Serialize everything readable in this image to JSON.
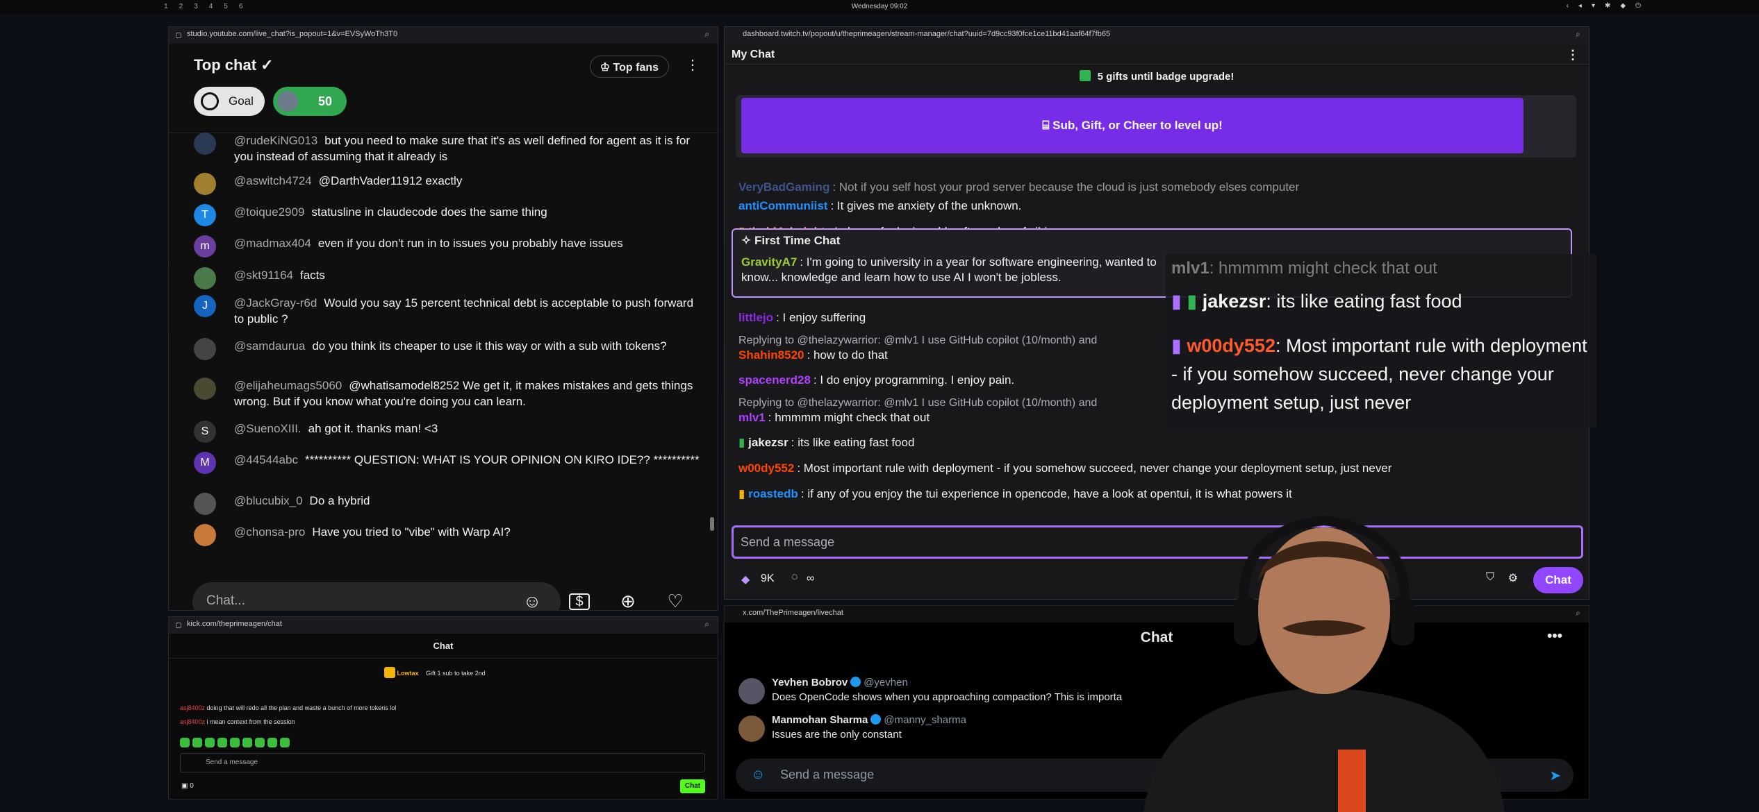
{
  "topbar": {
    "workspaces": [
      "1",
      "2",
      "3",
      "4",
      "5",
      "6"
    ],
    "clock": "Wednesday 09:02"
  },
  "youtube": {
    "url": "studio.youtube.com/live_chat?is_popout=1&v=EVSyWoTh3T0",
    "title": "Top chat",
    "top_fans": "Top fans",
    "goal": "Goal",
    "gift_count": "50",
    "input_placeholder": "Chat...",
    "messages": [
      {
        "author": "@rudeKiNG013",
        "text": "but you need to make sure that it's as well defined for agent as it is for you instead of assuming that it already is",
        "avatar": ""
      },
      {
        "author": "@aswitch4724",
        "text": "@DarthVader11912 exactly",
        "avatar": ""
      },
      {
        "author": "@toique2909",
        "text": "statusline in claudecode does the same thing",
        "avatar": "T"
      },
      {
        "author": "@madmax404",
        "text": "even if you don't run in to issues you probably have issues",
        "avatar": "m"
      },
      {
        "author": "@skt91164",
        "text": "facts",
        "avatar": ""
      },
      {
        "author": "@JackGray-r6d",
        "text": "Would you say 15 percent technical debt is acceptable to push forward to public ?",
        "avatar": "J"
      },
      {
        "author": "@samdaurua",
        "text": "do you think its cheaper to use it this way or with a sub with tokens?",
        "avatar": ""
      },
      {
        "author": "@elijaheumags5060",
        "text": "@whatisamodel8252 We get it, it makes mistakes and gets things wrong. But if you know what you're doing you can learn.",
        "avatar": ""
      },
      {
        "author": "@SuenoXIII.",
        "text": "ah got it. thanks man! <3",
        "avatar": "S"
      },
      {
        "author": "@44544abc",
        "text": "********** QUESTION: WHAT IS YOUR OPINION ON KIRO IDE?? **********",
        "avatar": "M"
      },
      {
        "author": "@blucubix_0",
        "text": "Do a hybrid",
        "avatar": ""
      },
      {
        "author": "@chonsa-pro",
        "text": "Have you tried to \"vibe\" with Warp AI?",
        "avatar": ""
      }
    ]
  },
  "kick": {
    "url": "kick.com/theprimeagen/chat",
    "title": "Chat",
    "pinned_user": "Lowtax",
    "pinned_text": "Gift 1 sub to take 2nd",
    "lines": [
      {
        "user": "asj8400z",
        "text": "doing that will redo all the plan and waste a bunch of more tokens lol"
      },
      {
        "user": "asj8400z",
        "text": "i mean context from the session"
      }
    ],
    "input_placeholder": "Send a message",
    "count": "0",
    "chat_button": "Chat"
  },
  "twitch": {
    "url": "dashboard.twitch.tv/popout/u/theprimeagen/stream-manager/chat?uuid=7d9cc93f0fce1ce11bd41aaf64f7fb65",
    "title": "My Chat",
    "gifts_banner": "5 gifts until badge upgrade!",
    "sub_button": "Sub, Gift, or Cheer to level up!",
    "first_time_chat": "First Time Chat",
    "lines": [
      {
        "user": "VeryBadGaming",
        "text": "Not if you self host your prod server because the cloud is just somebody elses computer",
        "color": "#5b7bd5"
      },
      {
        "user": "antiCommuniist",
        "text": "It gives me anxiety of the unknown.",
        "color": "#1e90ff"
      },
      {
        "user": "thebl4cknight",
        "text": "I always feel miserable after a day of vibing",
        "color": "#ff7f50"
      },
      {
        "user": "GravityA7",
        "text": "I'm going to university in a year for software engineering, wanted to know... knowledge and learn how to use AI I won't be jobless.",
        "color": "#9acd32"
      },
      {
        "user": "littlejo",
        "text": "I enjoy suffering",
        "color": "#8a2be2"
      },
      {
        "user": "Shahin8520",
        "text": "how to do that",
        "color": "#ff4500",
        "reply": "Replying to @thelazywarrior: @mlv1 I use GitHub copilot (10/month) and"
      },
      {
        "user": "spacenerd28",
        "text": "I do enjoy programming. I enjoy pain.",
        "color": "#b040ff"
      },
      {
        "user": "mlv1",
        "text": "hmmmm might check that out",
        "color": "#b040ff",
        "reply": "Replying to @thelazywarrior: @mlv1 I use GitHub copilot (10/month) and"
      },
      {
        "user": "jakezsr",
        "text": "its like eating fast food",
        "color": "#efeff1"
      },
      {
        "user": "w00dy552",
        "text": "Most important rule with deployment - if you somehow succeed, never change your deployment setup, just never",
        "color": "#ff4500"
      },
      {
        "user": "roastedb",
        "text": "if any of you enjoy the tui experience in opencode, have a look at opentui, it is what powers it",
        "color": "#1e90ff"
      }
    ],
    "input_placeholder": "Send a message",
    "bits": "9K",
    "points": "∞",
    "chat_button": "Chat"
  },
  "overlay": {
    "lines": [
      {
        "user": "mlv1",
        "text": "hmmmm might check that out"
      },
      {
        "user": "jakezsr",
        "text": "its like eating fast food"
      },
      {
        "user": "w00dy552",
        "text": "Most important rule with deployment - if you somehow succeed, never change your deployment setup, just never"
      }
    ]
  },
  "xchat": {
    "url": "x.com/ThePrimeagen/livechat",
    "title": "Chat",
    "messages": [
      {
        "name": "Yevhen Bobrov",
        "handle": "@yevhen",
        "text": "Does OpenCode shows when you approaching compaction? This is importa"
      },
      {
        "name": "Manmohan Sharma",
        "handle": "@manny_sharma",
        "text": "Issues are the only constant"
      }
    ],
    "input_placeholder": "Send a message"
  },
  "colors": {
    "twitch_purple": "#9147ff",
    "youtube_green": "#2fa84f",
    "kick_green": "#53fc18",
    "x_blue": "#1d9bf0"
  }
}
